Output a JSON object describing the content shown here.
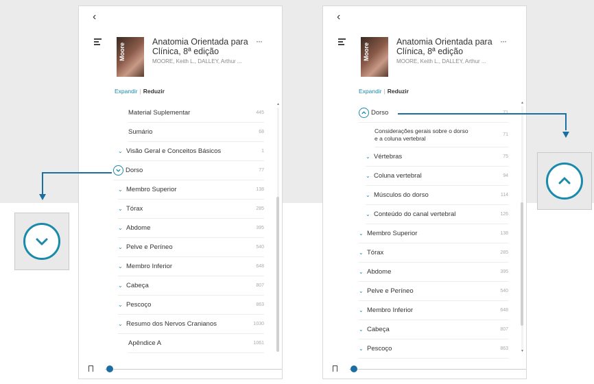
{
  "book": {
    "title": "Anatomia Orientada para Clínica, 8ª edição",
    "authors": "MOORE, Keith L., DALLEY, Arthur ...",
    "cover_text": "Moore",
    "more_label": "···"
  },
  "controls": {
    "back_label": "‹",
    "expand_label": "Expandir",
    "separator": "|",
    "reduce_label": "Reduzir"
  },
  "left_panel": {
    "toc": [
      {
        "label": "Material Suplementar",
        "page": "445",
        "type": "plain"
      },
      {
        "label": "Sumário",
        "page": "68",
        "type": "plain"
      },
      {
        "label": "Visão Geral e Conceitos Básicos",
        "page": "1",
        "type": "chevron"
      },
      {
        "label": "Dorso",
        "page": "77",
        "type": "circle-down"
      },
      {
        "label": "Membro Superior",
        "page": "138",
        "type": "chevron"
      },
      {
        "label": "Tórax",
        "page": "285",
        "type": "chevron"
      },
      {
        "label": "Abdome",
        "page": "395",
        "type": "chevron"
      },
      {
        "label": "Pelve e Períneo",
        "page": "540",
        "type": "chevron"
      },
      {
        "label": "Membro Inferior",
        "page": "648",
        "type": "chevron"
      },
      {
        "label": "Cabeça",
        "page": "807",
        "type": "chevron"
      },
      {
        "label": "Pescoço",
        "page": "863",
        "type": "chevron"
      },
      {
        "label": "Resumo dos Nervos Cranianos",
        "page": "1030",
        "type": "chevron"
      },
      {
        "label": "Apêndice A",
        "page": "1061",
        "type": "plain"
      }
    ]
  },
  "right_panel": {
    "toc": [
      {
        "label": "Dorso",
        "page": "71",
        "type": "circle-up",
        "level": 0
      },
      {
        "label": "Considerações gerais sobre o dorso e a coluna vertebral",
        "page": "71",
        "type": "plain",
        "level": 2
      },
      {
        "label": "Vértebras",
        "page": "75",
        "type": "chevron",
        "level": 1
      },
      {
        "label": "Coluna vertebral",
        "page": "94",
        "type": "chevron",
        "level": 1
      },
      {
        "label": "Músculos do dorso",
        "page": "114",
        "type": "chevron",
        "level": 1
      },
      {
        "label": "Conteúdo do canal vertebral",
        "page": "126",
        "type": "chevron",
        "level": 1
      },
      {
        "label": "Membro Superior",
        "page": "138",
        "type": "chevron",
        "level": 0
      },
      {
        "label": "Tórax",
        "page": "285",
        "type": "chevron",
        "level": 0
      },
      {
        "label": "Abdome",
        "page": "395",
        "type": "chevron",
        "level": 0
      },
      {
        "label": "Pelve e Períneo",
        "page": "540",
        "type": "chevron",
        "level": 0
      },
      {
        "label": "Membro Inferior",
        "page": "648",
        "type": "chevron",
        "level": 0
      },
      {
        "label": "Cabeça",
        "page": "807",
        "type": "chevron",
        "level": 0
      },
      {
        "label": "Pescoço",
        "page": "863",
        "type": "chevron",
        "level": 0
      }
    ]
  },
  "reading_progress": 0.03,
  "colors": {
    "accent": "#1a8aaa",
    "callout": "#1b6fa0",
    "background_band": "#ebebeb"
  },
  "icons": {
    "back": "chevron-left-icon",
    "menu": "menu-lines-icon",
    "more": "more-dots-icon",
    "bookmark": "bookmark-icon",
    "expand_chevron": "chevron-down-icon",
    "collapse_circle": "chevron-up-circle-icon",
    "expand_circle": "chevron-down-circle-icon"
  }
}
